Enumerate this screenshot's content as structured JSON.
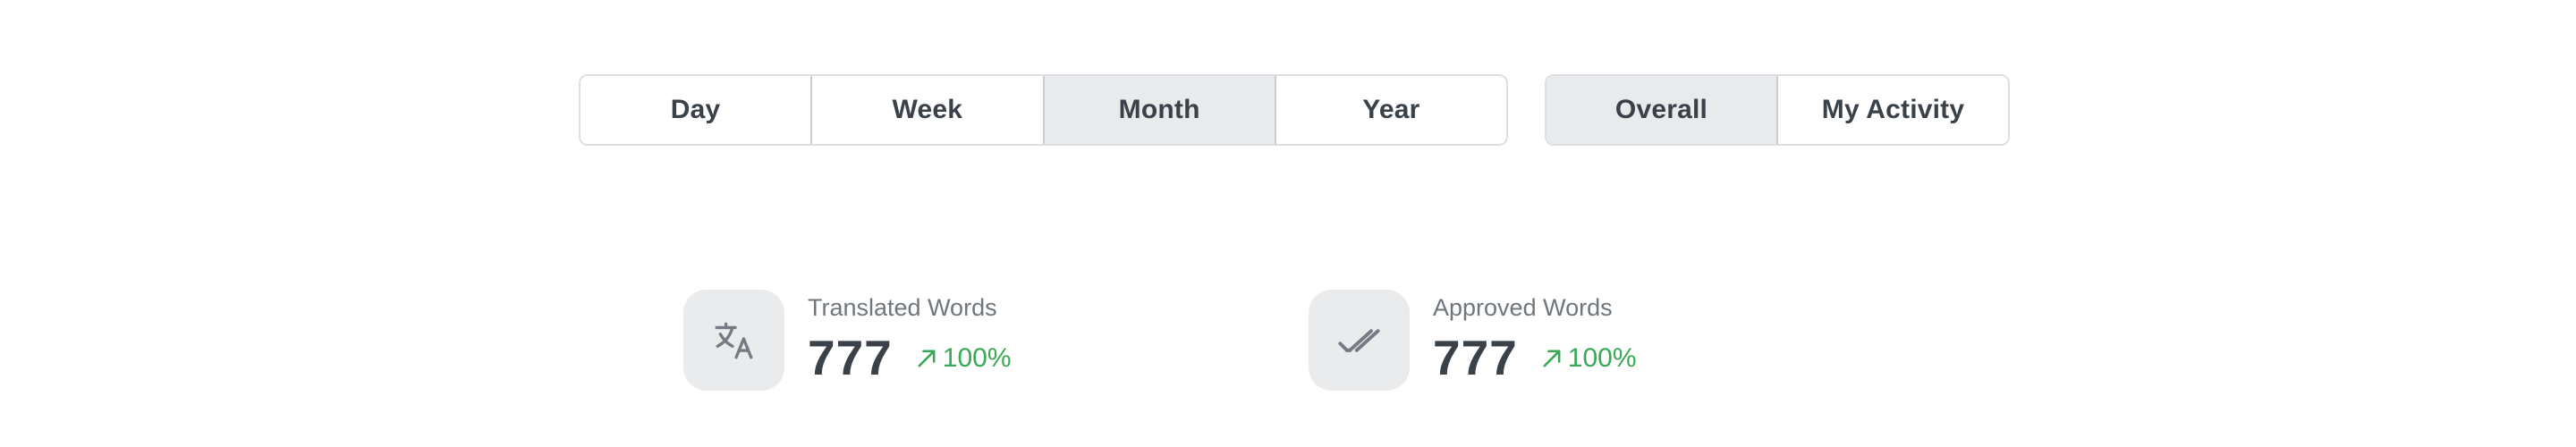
{
  "period_filter": {
    "options": [
      "Day",
      "Week",
      "Month",
      "Year"
    ],
    "selected": "Month"
  },
  "scope_filter": {
    "options": [
      "Overall",
      "My Activity"
    ],
    "selected": "Overall"
  },
  "stats": {
    "translated": {
      "label": "Translated Words",
      "value": "777",
      "change": "100%",
      "icon": "translate-icon",
      "trend_icon": "trend-up-icon"
    },
    "approved": {
      "label": "Approved Words",
      "value": "777",
      "change": "100%",
      "icon": "double-check-icon",
      "trend_icon": "trend-up-icon"
    }
  },
  "colors": {
    "active_segment": "#e8eaeb",
    "border": "#dcdfe3",
    "positive": "#3aa855",
    "icon_tile": "#e9ebed",
    "text_dark": "#3a4149",
    "text_muted": "#6f767d"
  }
}
